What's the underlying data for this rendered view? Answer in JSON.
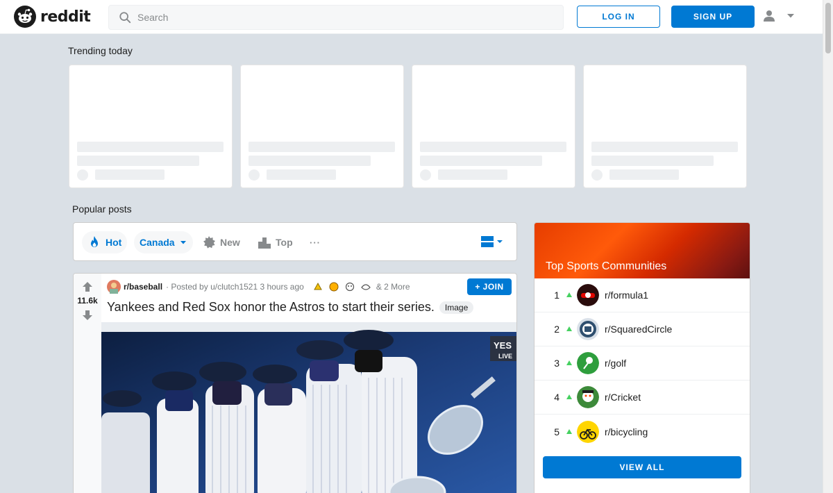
{
  "header": {
    "logo_text": "reddit",
    "search_placeholder": "Search",
    "login_label": "LOG IN",
    "signup_label": "SIGN UP"
  },
  "trending": {
    "title": "Trending today"
  },
  "popular": {
    "title": "Popular posts",
    "sort": {
      "hot": "Hot",
      "region": "Canada",
      "new": "New",
      "top": "Top",
      "more": "···"
    }
  },
  "post": {
    "votes": "11.6k",
    "subreddit": "r/baseball",
    "posted_by": "· Posted by u/clutch1521 3 hours ago",
    "awards_more": "& 2 More",
    "join_label": "+ JOIN",
    "title": "Yankees and Red Sox honor the Astros to start their series.",
    "flair": "Image"
  },
  "sidebar": {
    "title": "Top Sports Communities",
    "communities": [
      {
        "rank": "1",
        "name": "r/formula1",
        "color": "#9b1b1b"
      },
      {
        "rank": "2",
        "name": "r/SquaredCircle",
        "color": "#2f4f6f"
      },
      {
        "rank": "3",
        "name": "r/golf",
        "color": "#2e9e3d"
      },
      {
        "rank": "4",
        "name": "r/Cricket",
        "color": "#3d8a3a"
      },
      {
        "rank": "5",
        "name": "r/bicycling",
        "color": "#ffd500"
      }
    ],
    "view_all_label": "VIEW ALL"
  },
  "colors": {
    "brand_blue": "#0079d3",
    "upvote_green": "#46d160",
    "background": "#dae0e6"
  }
}
